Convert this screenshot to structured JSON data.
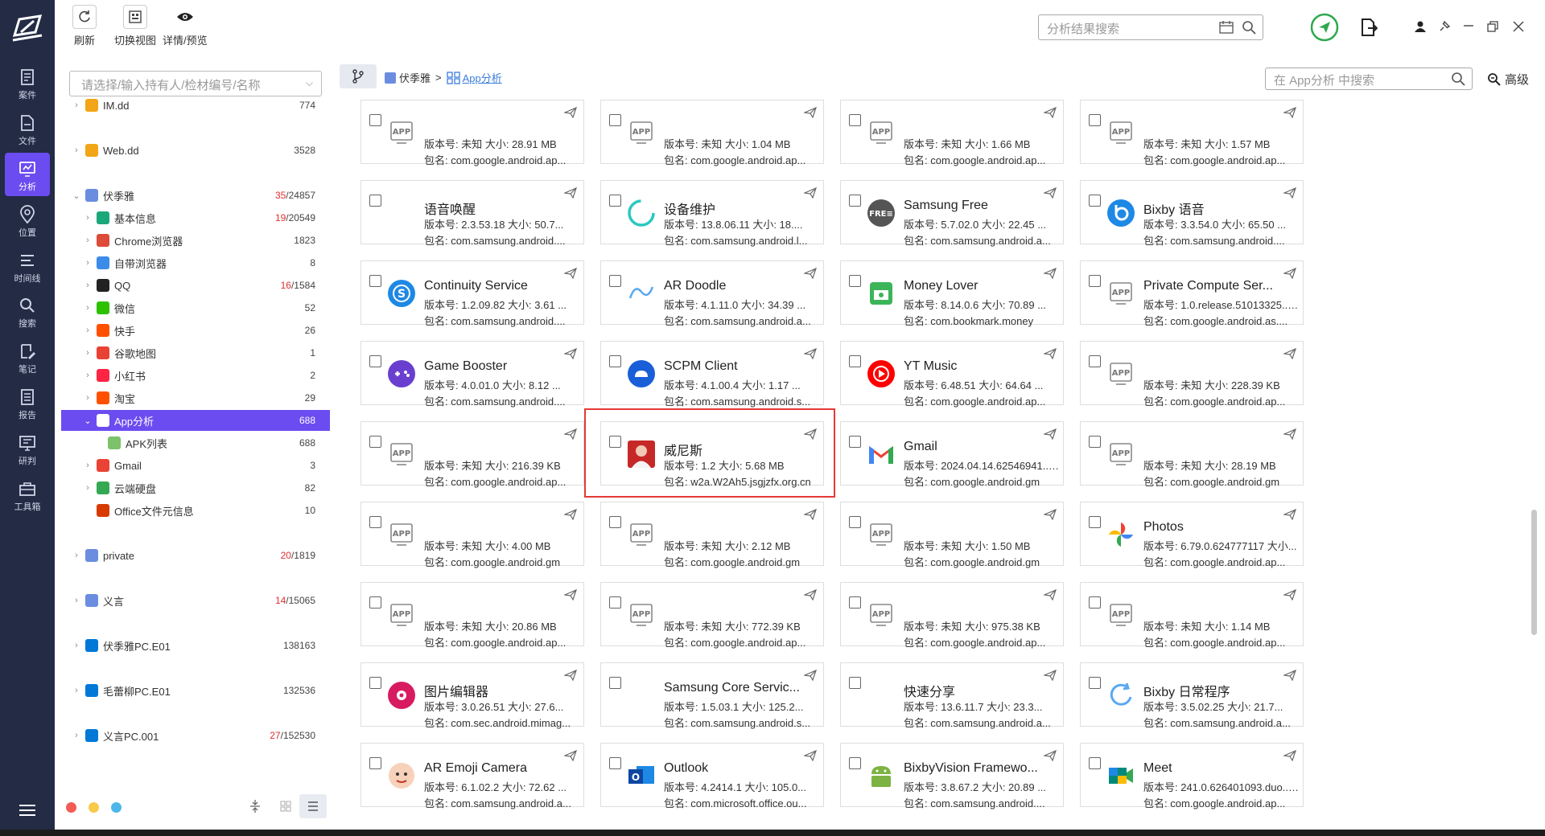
{
  "nav": [
    {
      "id": "case",
      "label": "案件",
      "icon": "folder-case-icon"
    },
    {
      "id": "file",
      "label": "文件",
      "icon": "file-icon"
    },
    {
      "id": "analysis",
      "label": "分析",
      "icon": "monitor-analysis-icon",
      "active": true
    },
    {
      "id": "location",
      "label": "位置",
      "icon": "location-pin-icon"
    },
    {
      "id": "timeline",
      "label": "时间线",
      "icon": "timeline-icon"
    },
    {
      "id": "search",
      "label": "搜索",
      "icon": "search-icon"
    },
    {
      "id": "notes",
      "label": "笔记",
      "icon": "notes-icon"
    },
    {
      "id": "report",
      "label": "报告",
      "icon": "report-icon"
    },
    {
      "id": "research",
      "label": "研判",
      "icon": "research-icon"
    },
    {
      "id": "toolbox",
      "label": "工具箱",
      "icon": "toolbox-icon"
    }
  ],
  "toolbar": {
    "refresh": "刷新",
    "switch_view": "切换视图",
    "detail_preview": "详情/预览"
  },
  "global_search": {
    "placeholder": "分析结果搜索"
  },
  "case_select": {
    "placeholder": "请选择/输入持有人/检材编号/名称"
  },
  "tree": [
    {
      "label": "IM.dd",
      "count": "774",
      "indent": 0,
      "arrow": "›",
      "color": "#f2a516"
    },
    {
      "label": "Web.dd",
      "count": "3528",
      "indent": 0,
      "arrow": "›",
      "color": "#f2a516"
    },
    {
      "label": "伏季雅",
      "count_red": "35",
      "count": "/24857",
      "indent": 0,
      "arrow": "⌄",
      "color": "#6b8de0"
    },
    {
      "label": "基本信息",
      "count_red": "19",
      "count": "/20549",
      "indent": 1,
      "arrow": "›",
      "color": "#1aa87a"
    },
    {
      "label": "Chrome浏览器",
      "count": "1823",
      "indent": 1,
      "arrow": "›",
      "color": "#dd4b39"
    },
    {
      "label": "自带浏览器",
      "count": "8",
      "indent": 1,
      "arrow": "›",
      "color": "#3b8be8"
    },
    {
      "label": "QQ",
      "count_red": "16",
      "count": "/1584",
      "indent": 1,
      "arrow": "›",
      "color": "#222"
    },
    {
      "label": "微信",
      "count": "52",
      "indent": 1,
      "arrow": "›",
      "color": "#2dc100"
    },
    {
      "label": "快手",
      "count": "26",
      "indent": 1,
      "arrow": "›",
      "color": "#ff5000"
    },
    {
      "label": "谷歌地图",
      "count": "1",
      "indent": 1,
      "arrow": "›",
      "color": "#e94235"
    },
    {
      "label": "小红书",
      "count": "2",
      "indent": 1,
      "arrow": "›",
      "color": "#ff2442"
    },
    {
      "label": "淘宝",
      "count": "29",
      "indent": 1,
      "arrow": "›",
      "color": "#ff5000"
    },
    {
      "label": "App分析",
      "count": "688",
      "indent": 1,
      "arrow": "⌄",
      "color": "#fff",
      "selected": true
    },
    {
      "label": "APK列表",
      "count": "688",
      "indent": 2,
      "arrow": "",
      "color": "#7cc26b"
    },
    {
      "label": "Gmail",
      "count": "3",
      "indent": 1,
      "arrow": "›",
      "color": "#ea4335"
    },
    {
      "label": "云端硬盘",
      "count": "82",
      "indent": 1,
      "arrow": "›",
      "color": "#34a853"
    },
    {
      "label": "Office文件元信息",
      "count": "10",
      "indent": 1,
      "arrow": "",
      "color": "#d83b01"
    },
    {
      "label": "private",
      "count_red": "20",
      "count": "/1819",
      "indent": 0,
      "arrow": "›",
      "color": "#6b8de0"
    },
    {
      "label": "义言",
      "count_red": "14",
      "count": "/15065",
      "indent": 0,
      "arrow": "›",
      "color": "#6b8de0"
    },
    {
      "label": "伏季雅PC.E01",
      "count": "138163",
      "indent": 0,
      "arrow": "›",
      "color": "#0078d7"
    },
    {
      "label": "毛蕾柳PC.E01",
      "count": "132536",
      "indent": 0,
      "arrow": "›",
      "color": "#0078d7"
    },
    {
      "label": "义言PC.001",
      "count_red": "27",
      "count": "/152530",
      "indent": 0,
      "arrow": "›",
      "color": "#0078d7"
    }
  ],
  "breadcrumb": {
    "root": "伏季雅",
    "sep": ">",
    "current": "App分析"
  },
  "content_search": {
    "placeholder": "在 App分析 中搜索"
  },
  "advanced": "高级",
  "labels": {
    "version": "版本号:",
    "size": "大小:",
    "package": "包名:"
  },
  "cards": [
    {
      "name": "",
      "ver": "未知",
      "size": "28.91 MB",
      "pkg": "com.google.android.ap...",
      "icon": "app-placeholder-icon"
    },
    {
      "name": "",
      "ver": "未知",
      "size": "1.04 MB",
      "pkg": "com.google.android.ap...",
      "icon": "app-placeholder-icon"
    },
    {
      "name": "",
      "ver": "未知",
      "size": "1.66 MB",
      "pkg": "com.google.android.ap...",
      "icon": "app-placeholder-icon"
    },
    {
      "name": "",
      "ver": "未知",
      "size": "1.57 MB",
      "pkg": "com.google.android.ap...",
      "icon": "app-placeholder-icon"
    },
    {
      "name": "语音唤醒",
      "ver": "2.3.53.18",
      "size": "50.7...",
      "pkg": "com.samsung.android....",
      "icon": "blank-icon"
    },
    {
      "name": "设备维护",
      "ver": "13.8.06.11",
      "size": "18....",
      "pkg": "com.samsung.android.l...",
      "icon": "device-care-icon"
    },
    {
      "name": "Samsung Free",
      "ver": "5.7.02.0",
      "size": "22.45 ...",
      "pkg": "com.samsung.android.a...",
      "icon": "samsung-free-icon"
    },
    {
      "name": "Bixby 语音",
      "ver": "3.3.54.0",
      "size": "65.50 ...",
      "pkg": "com.samsung.android....",
      "icon": "bixby-icon"
    },
    {
      "name": "Continuity Service",
      "ver": "1.2.09.82",
      "size": "3.61 ...",
      "pkg": "com.samsung.android....",
      "icon": "continuity-icon"
    },
    {
      "name": "AR Doodle",
      "ver": "4.1.11.0",
      "size": "34.39 ...",
      "pkg": "com.samsung.android.a...",
      "icon": "ar-doodle-icon"
    },
    {
      "name": "Money Lover",
      "ver": "8.14.0.6",
      "size": "70.89 ...",
      "pkg": "com.bookmark.money",
      "icon": "money-lover-icon"
    },
    {
      "name": "Private Compute Ser...",
      "ver": "1.0.release.51013325...",
      "size": "",
      "pkg": "com.google.android.as....",
      "icon": "app-placeholder-icon"
    },
    {
      "name": "Game Booster",
      "ver": "4.0.01.0",
      "size": "8.12 ...",
      "pkg": "com.samsung.android....",
      "icon": "game-booster-icon"
    },
    {
      "name": "SCPM Client",
      "ver": "4.1.00.4",
      "size": "1.17 ...",
      "pkg": "com.samsung.android.s...",
      "icon": "scpm-icon"
    },
    {
      "name": "YT Music",
      "ver": "6.48.51",
      "size": "64.64 ...",
      "pkg": "com.google.android.ap...",
      "icon": "yt-music-icon"
    },
    {
      "name": "",
      "ver": "未知",
      "size": "228.39 KB",
      "pkg": "com.google.android.ap...",
      "icon": "app-placeholder-icon"
    },
    {
      "name": "",
      "ver": "未知",
      "size": "216.39 KB",
      "pkg": "com.google.android.ap...",
      "icon": "app-placeholder-icon"
    },
    {
      "name": "威尼斯",
      "ver": "1.2",
      "size": "5.68 MB",
      "pkg": "w2a.W2Ah5.jsgjzfx.org.cn",
      "icon": "venice-app-icon"
    },
    {
      "name": "Gmail",
      "ver": "2024.04.14.62546941...",
      "size": "",
      "pkg": "com.google.android.gm",
      "icon": "gmail-icon"
    },
    {
      "name": "",
      "ver": "未知",
      "size": "28.19 MB",
      "pkg": "com.google.android.gm",
      "icon": "app-placeholder-icon"
    },
    {
      "name": "",
      "ver": "未知",
      "size": "4.00 MB",
      "pkg": "com.google.android.gm",
      "icon": "app-placeholder-icon"
    },
    {
      "name": "",
      "ver": "未知",
      "size": "2.12 MB",
      "pkg": "com.google.android.gm",
      "icon": "app-placeholder-icon"
    },
    {
      "name": "",
      "ver": "未知",
      "size": "1.50 MB",
      "pkg": "com.google.android.gm",
      "icon": "app-placeholder-icon"
    },
    {
      "name": "Photos",
      "ver": "6.79.0.624777117",
      "size": "",
      "pkg": "com.google.android.ap...",
      "icon": "photos-icon"
    },
    {
      "name": "",
      "ver": "未知",
      "size": "20.86 MB",
      "pkg": "com.google.android.ap...",
      "icon": "app-placeholder-icon"
    },
    {
      "name": "",
      "ver": "未知",
      "size": "772.39 KB",
      "pkg": "com.google.android.ap...",
      "icon": "app-placeholder-icon"
    },
    {
      "name": "",
      "ver": "未知",
      "size": "975.38 KB",
      "pkg": "com.google.android.ap...",
      "icon": "app-placeholder-icon"
    },
    {
      "name": "",
      "ver": "未知",
      "size": "1.14 MB",
      "pkg": "com.google.android.ap...",
      "icon": "app-placeholder-icon"
    },
    {
      "name": "图片编辑器",
      "ver": "3.0.26.51",
      "size": "27.6...",
      "pkg": "com.sec.android.mimag...",
      "icon": "photo-editor-icon"
    },
    {
      "name": "Samsung Core Servic...",
      "ver": "1.5.03.1",
      "size": "125.2...",
      "pkg": "com.samsung.android.s...",
      "icon": "blank-icon"
    },
    {
      "name": "快速分享",
      "ver": "13.6.11.7",
      "size": "23.3...",
      "pkg": "com.samsung.android.a...",
      "icon": "blank-icon"
    },
    {
      "name": "Bixby 日常程序",
      "ver": "3.5.02.25",
      "size": "21.7...",
      "pkg": "com.samsung.android.a...",
      "icon": "bixby-routines-icon"
    },
    {
      "name": "AR Emoji Camera",
      "ver": "6.1.02.2",
      "size": "72.62 ...",
      "pkg": "com.samsung.android.a...",
      "icon": "ar-emoji-icon"
    },
    {
      "name": "Outlook",
      "ver": "4.2414.1",
      "size": "105.0...",
      "pkg": "com.microsoft.office.ou...",
      "icon": "outlook-icon"
    },
    {
      "name": "BixbyVision Framewo...",
      "ver": "3.8.67.2",
      "size": "20.89 ...",
      "pkg": "com.samsung.android....",
      "icon": "android-icon"
    },
    {
      "name": "Meet",
      "ver": "241.0.626401093.duo...",
      "size": "",
      "pkg": "com.google.android.ap...",
      "icon": "meet-icon"
    }
  ]
}
